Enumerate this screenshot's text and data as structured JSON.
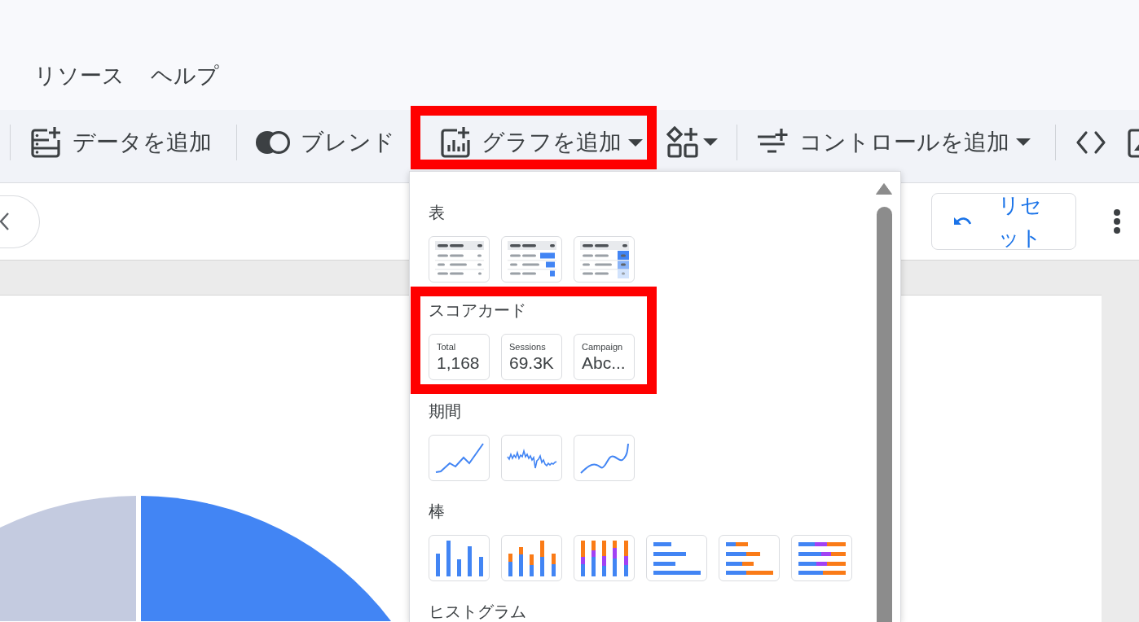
{
  "menu_bar": {
    "items": [
      {
        "label": "リソース"
      },
      {
        "label": "ヘルプ"
      }
    ]
  },
  "toolbar": {
    "items": [
      {
        "kind": "separator"
      },
      {
        "kind": "button",
        "label": "データを追加",
        "dropdown": false,
        "highlighted": false,
        "expanded": false
      },
      {
        "kind": "separator"
      },
      {
        "kind": "button",
        "label": "ブレンド",
        "dropdown": false,
        "highlighted": false,
        "expanded": false
      },
      {
        "kind": "button",
        "label": "グラフを追加",
        "dropdown": true,
        "highlighted": true,
        "expanded": true
      },
      {
        "kind": "icon_button",
        "dropdown": true,
        "highlighted": false,
        "expanded": false
      },
      {
        "kind": "separator"
      },
      {
        "kind": "button",
        "label": "コントロールを追加",
        "dropdown": true,
        "highlighted": false,
        "expanded": false
      },
      {
        "kind": "separator"
      },
      {
        "kind": "icon_button",
        "dropdown": false,
        "highlighted": false,
        "expanded": false
      },
      {
        "kind": "icon_button",
        "dropdown": false,
        "highlighted": false,
        "expanded": false
      }
    ]
  },
  "header": {
    "reset_button": {
      "label": "リセット"
    }
  },
  "chart_menu": {
    "sections": [
      {
        "title": "表",
        "highlighted": false,
        "options": [
          {
            "kind": "table"
          },
          {
            "kind": "table_bars"
          },
          {
            "kind": "table_heatmap"
          }
        ]
      },
      {
        "title": "スコアカード",
        "highlighted": true,
        "options": [
          {
            "kind": "scorecard",
            "label": "Total",
            "value": "1,168"
          },
          {
            "kind": "scorecard",
            "label": "Sessions",
            "value": "69.3K"
          },
          {
            "kind": "scorecard",
            "label": "Campaign",
            "value": "Abc..."
          }
        ]
      },
      {
        "title": "期間",
        "highlighted": false,
        "options": [
          {
            "kind": "line"
          },
          {
            "kind": "line_jagged"
          },
          {
            "kind": "line_smooth"
          }
        ]
      },
      {
        "title": "棒",
        "highlighted": false,
        "options": [
          {
            "kind": "column"
          },
          {
            "kind": "column_stacked"
          },
          {
            "kind": "column_stacked_100"
          },
          {
            "kind": "bar"
          },
          {
            "kind": "bar_stacked"
          },
          {
            "kind": "bar_stacked_100"
          }
        ]
      },
      {
        "title": "ヒストグラム",
        "highlighted": false
      }
    ]
  }
}
